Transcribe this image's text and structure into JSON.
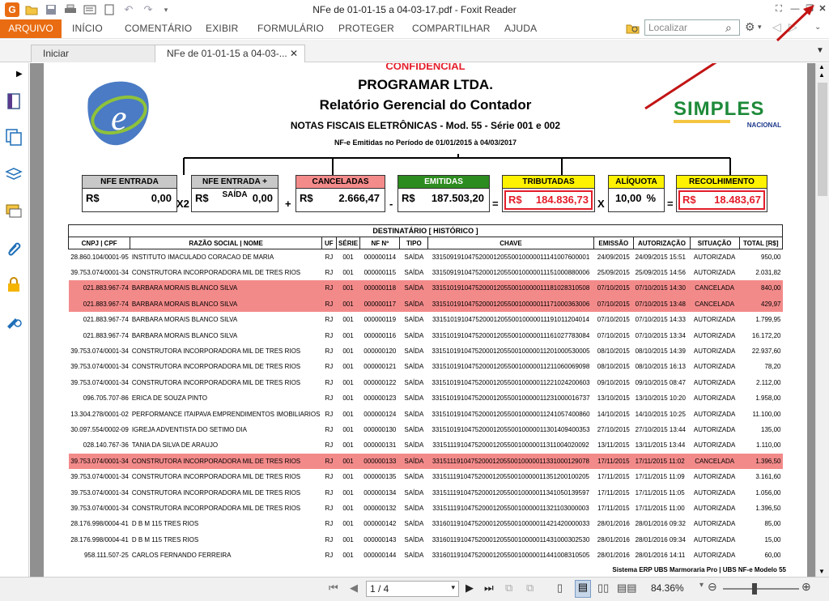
{
  "window": {
    "title": "NFe de 01-01-15 a 04-03-17.pdf - Foxit Reader"
  },
  "ribbon": {
    "file_label": "ARQUIVO",
    "tabs": [
      "INÍCIO",
      "COMENTÁRIO",
      "EXIBIR",
      "FORMULÁRIO",
      "PROTEGER",
      "COMPARTILHAR",
      "AJUDA"
    ],
    "search_placeholder": "Localizar"
  },
  "doc_tabs": [
    {
      "label": "Iniciar"
    },
    {
      "label": "NFe de 01-01-15 a 04-03-..."
    }
  ],
  "report": {
    "confidential": "CONFIDENCIAL",
    "company": "PROGRAMAR LTDA.",
    "title": "Relatório Gerencial do Contador",
    "subtitle": "NOTAS FISCAIS ELETRÔNICAS - Mod. 55 - Série 001 e 002",
    "period": "NF-e Emitidas no Período de 01/01/2015 à 04/03/2017",
    "simples": "SIMPLES",
    "nacional": "NACIONAL",
    "summary": {
      "nfe_entrada": {
        "label": "NFE ENTRADA",
        "cur": "R$",
        "value": "0,00"
      },
      "nfe_entrada_saida": {
        "label": "NFE ENTRADA + SAÍDA",
        "cur": "R$",
        "value": "0,00"
      },
      "canceladas": {
        "label": "CANCELADAS",
        "cur": "R$",
        "value": "2.666,47"
      },
      "emitidas": {
        "label": "EMITIDAS",
        "cur": "R$",
        "value": "187.503,20"
      },
      "tributadas": {
        "label": "TRIBUTADAS",
        "cur": "R$",
        "value": "184.836,73"
      },
      "aliquota": {
        "label": "ALÍQUOTA",
        "value": "10,00",
        "unit": "%"
      },
      "recolhimento": {
        "label": "RECOLHIMENTO",
        "cur": "R$",
        "value": "18.483,67"
      },
      "ops": {
        "x2": "X2",
        "plus": "+",
        "minus": "-",
        "eq": "=",
        "x": "X",
        "eq2": "="
      }
    },
    "table_title": "DESTINATÁRIO [ HISTÓRICO ]",
    "columns": [
      "CNPJ | CPF",
      "RAZÃO SOCIAL | NOME",
      "UF",
      "SÉRIE",
      "NF Nº",
      "TIPO",
      "CHAVE",
      "EMISSÃO",
      "AUTORIZAÇÃO",
      "SITUAÇÃO",
      "TOTAL [R$]"
    ],
    "rows": [
      [
        "28.860.104/0001-95",
        "INSTITUTO IMACULADO CORACAO DE MARIA",
        "RJ",
        "001",
        "000000114",
        "SAÍDA",
        "33150919104752000120550010000011141007600001",
        "24/09/2015",
        "24/09/2015 15:51",
        "AUTORIZADA",
        "950,00"
      ],
      [
        "39.753.074/0001-34",
        "CONSTRUTORA INCORPORADORA MIL DE TRES RIOS",
        "RJ",
        "001",
        "000000115",
        "SAÍDA",
        "33150919104752000120550010000011151000880006",
        "25/09/2015",
        "25/09/2015 14:56",
        "AUTORIZADA",
        "2.031,82"
      ],
      [
        "021.883.967-74",
        "BARBARA MORAIS BLANCO SILVA",
        "RJ",
        "001",
        "000000118",
        "SAÍDA",
        "33151019104752000120550010000011181028310508",
        "07/10/2015",
        "07/10/2015 14:30",
        "CANCELADA",
        "840,00"
      ],
      [
        "021.883.967-74",
        "BARBARA MORAIS BLANCO SILVA",
        "RJ",
        "001",
        "000000117",
        "SAÍDA",
        "33151019104752000120550010000011171000363006",
        "07/10/2015",
        "07/10/2015 13:48",
        "CANCELADA",
        "429,97"
      ],
      [
        "021.883.967-74",
        "BARBARA MORAIS BLANCO SILVA",
        "RJ",
        "001",
        "000000119",
        "SAÍDA",
        "33151019104752000120550010000011191011204014",
        "07/10/2015",
        "07/10/2015 14:33",
        "AUTORIZADA",
        "1.799,95"
      ],
      [
        "021.883.967-74",
        "BARBARA MORAIS BLANCO SILVA",
        "RJ",
        "001",
        "000000116",
        "SAÍDA",
        "33151019104752000120550010000011161027783084",
        "07/10/2015",
        "07/10/2015 13:34",
        "AUTORIZADA",
        "16.172,20"
      ],
      [
        "39.753.074/0001-34",
        "CONSTRUTORA INCORPORADORA MIL DE TRES RIOS",
        "RJ",
        "001",
        "000000120",
        "SAÍDA",
        "33151019104752000120550010000011201000530005",
        "08/10/2015",
        "08/10/2015 14:39",
        "AUTORIZADA",
        "22.937,60"
      ],
      [
        "39.753.074/0001-34",
        "CONSTRUTORA INCORPORADORA MIL DE TRES RIOS",
        "RJ",
        "001",
        "000000121",
        "SAÍDA",
        "33151019104752000120550010000011211060069098",
        "08/10/2015",
        "08/10/2015 16:13",
        "AUTORIZADA",
        "78,20"
      ],
      [
        "39.753.074/0001-34",
        "CONSTRUTORA INCORPORADORA MIL DE TRES RIOS",
        "RJ",
        "001",
        "000000122",
        "SAÍDA",
        "33151019104752000120550010000011221024200603",
        "09/10/2015",
        "09/10/2015 08:47",
        "AUTORIZADA",
        "2.112,00"
      ],
      [
        "096.705.707-86",
        "ERICA DE SOUZA PINTO",
        "RJ",
        "001",
        "000000123",
        "SAÍDA",
        "33151019104752000120550010000011231000016737",
        "13/10/2015",
        "13/10/2015 10:20",
        "AUTORIZADA",
        "1.958,00"
      ],
      [
        "13.304.278/0001-02",
        "PERFORMANCE ITAIPAVA EMPRENDIMENTOS IMOBILIARIOS",
        "RJ",
        "001",
        "000000124",
        "SAÍDA",
        "33151019104752000120550010000011241057400860",
        "14/10/2015",
        "14/10/2015 10:25",
        "AUTORIZADA",
        "11.100,00"
      ],
      [
        "30.097.554/0002-09",
        "IGREJA ADVENTISTA DO SETIMO DIA",
        "RJ",
        "001",
        "000000130",
        "SAÍDA",
        "33151019104752000120550010000011301409400353",
        "27/10/2015",
        "27/10/2015 13:44",
        "AUTORIZADA",
        "135,00"
      ],
      [
        "028.140.767-36",
        "TANIA DA SILVA DE ARAUJO",
        "RJ",
        "001",
        "000000131",
        "SAÍDA",
        "33151119104752000120550010000011311004020092",
        "13/11/2015",
        "13/11/2015 13:44",
        "AUTORIZADA",
        "1.110,00"
      ],
      [
        "39.753.074/0001-34",
        "CONSTRUTORA INCORPORADORA MIL DE TRES RIOS",
        "RJ",
        "001",
        "000000133",
        "SAÍDA",
        "33151119104752000120550010000011331000129078",
        "17/11/2015",
        "17/11/2015 11:02",
        "CANCELADA",
        "1.396,50"
      ],
      [
        "39.753.074/0001-34",
        "CONSTRUTORA INCORPORADORA MIL DE TRES RIOS",
        "RJ",
        "001",
        "000000135",
        "SAÍDA",
        "33151119104752000120550010000011351200100205",
        "17/11/2015",
        "17/11/2015 11:09",
        "AUTORIZADA",
        "3.161,60"
      ],
      [
        "39.753.074/0001-34",
        "CONSTRUTORA INCORPORADORA MIL DE TRES RIOS",
        "RJ",
        "001",
        "000000134",
        "SAÍDA",
        "33151119104752000120550010000011341050139597",
        "17/11/2015",
        "17/11/2015 11:05",
        "AUTORIZADA",
        "1.056,00"
      ],
      [
        "39.753.074/0001-34",
        "CONSTRUTORA INCORPORADORA MIL DE TRES RIOS",
        "RJ",
        "001",
        "000000132",
        "SAÍDA",
        "33151119104752000120550010000011321103000003",
        "17/11/2015",
        "17/11/2015 11:00",
        "AUTORIZADA",
        "1.396,50"
      ],
      [
        "28.176.998/0004-41",
        "D B M 115 TRES RIOS",
        "RJ",
        "001",
        "000000142",
        "SAÍDA",
        "33160119104752000120550010000011421420000033",
        "28/01/2016",
        "28/01/2016 09:32",
        "AUTORIZADA",
        "85,00"
      ],
      [
        "28.176.998/0004-41",
        "D B M 115 TRES RIOS",
        "RJ",
        "001",
        "000000143",
        "SAÍDA",
        "33160119104752000120550010000011431000302530",
        "28/01/2016",
        "28/01/2016 09:34",
        "AUTORIZADA",
        "15,00"
      ],
      [
        "958.111.507-25",
        "CARLOS FERNANDO FERREIRA",
        "RJ",
        "001",
        "000000144",
        "SAÍDA",
        "33160119104752000120550010000011441008310505",
        "28/01/2016",
        "28/01/2016 14:11",
        "AUTORIZADA",
        "60,00"
      ]
    ],
    "footer": "Sistema ERP UBS Marmoraria Pro | UBS NF-e Modelo 55"
  },
  "status": {
    "page": "1 / 4",
    "zoom": "84.36%"
  },
  "colors": {
    "accent": "#e96c12",
    "cancelled_row": "#f38a8a",
    "red_box": "#e41e2b",
    "green_box": "#2d8c1f",
    "yellow_box": "#fff200",
    "salmon_box": "#f48b8b",
    "arrow": "#c21515"
  }
}
